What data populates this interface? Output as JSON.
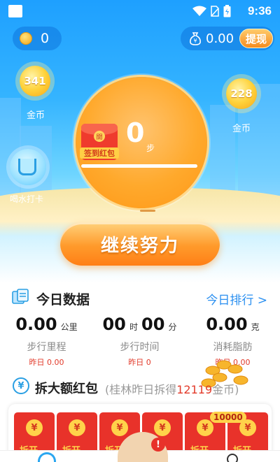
{
  "status_bar": {
    "time": "9:36"
  },
  "top": {
    "coins": "0",
    "cash": "0.00",
    "withdraw_label": "提现"
  },
  "bubbles": {
    "left": {
      "value": "341",
      "label": "金币"
    },
    "right": {
      "value": "228",
      "label": "金币"
    },
    "water_label": "喝水打卡"
  },
  "pedometer": {
    "redpack_label": "签到红包",
    "redpack_seal": "開",
    "steps": "0",
    "steps_unit": "步",
    "progress_fraction": 1.0
  },
  "continue_button": "继续努力",
  "today": {
    "title": "今日数据",
    "rank_link": "今日排行 >",
    "stats": [
      {
        "value": "0.00",
        "unit": "公里",
        "label": "步行里程",
        "yesterday": "昨日 0.00"
      },
      {
        "hours": "00",
        "hours_unit": "时",
        "minutes": "00",
        "minutes_unit": "分",
        "label": "步行时间",
        "yesterday": "昨日 0"
      },
      {
        "value": "0.00",
        "unit": "克",
        "label": "消耗脂肪",
        "yesterday": "昨日 0.00"
      }
    ]
  },
  "redpacks": {
    "title": "拆大额红包",
    "subtitle_prefix": "(桂林昨日拆得",
    "subtitle_amount": "12119",
    "subtitle_suffix": "金币)",
    "envelope_symbol": "¥",
    "envelopes": [
      "拆开",
      "拆开",
      "拆开",
      "拆开",
      "拆开",
      "拆开"
    ],
    "bonus_tag": "10000"
  },
  "nav": {
    "alert": "!"
  },
  "colors": {
    "sky": "#1ea0ff",
    "accent_orange": "#ff9a2b",
    "link_blue": "#2a8ff0",
    "red": "#e23a2a"
  },
  "icons": [
    "status-square-icon",
    "wifi-icon",
    "sim-icon",
    "battery-icon",
    "coin-icon",
    "money-bag-icon",
    "water-cup-icon",
    "calendar-icon",
    "yen-icon",
    "home-icon",
    "profile-icon"
  ]
}
